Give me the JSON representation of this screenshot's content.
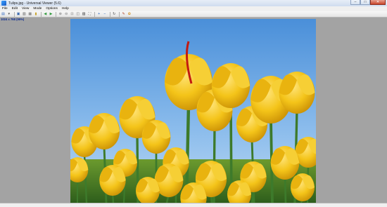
{
  "window": {
    "title": "Tulips.jpg - Universal Viewer (5.6)",
    "controls": [
      "–",
      "□",
      "✕"
    ]
  },
  "menu": {
    "items": [
      "File",
      "Edit",
      "View",
      "Mode",
      "Options",
      "Help"
    ]
  },
  "toolbar": {
    "buttons": [
      {
        "name": "open-icon",
        "glyph": "▤",
        "color": "#3a6fc4"
      },
      {
        "name": "dropdown-icon",
        "glyph": "▾",
        "color": "#444444"
      },
      {
        "name": "save-icon",
        "glyph": "▣",
        "color": "#2d5fa8"
      },
      {
        "name": "print-icon",
        "glyph": "▥",
        "color": "#555555"
      },
      {
        "name": "properties-icon",
        "glyph": "▦",
        "color": "#6a6a6a"
      },
      {
        "name": "delete-icon",
        "glyph": "▮",
        "color": "#c8a020"
      },
      {
        "name": "back-icon",
        "glyph": "◀",
        "color": "#2e9a3a"
      },
      {
        "name": "forward-icon",
        "glyph": "▶",
        "color": "#2e9a3a"
      },
      {
        "name": "zoom-in-icon",
        "glyph": "⊕",
        "color": "#777777"
      },
      {
        "name": "zoom-out-icon",
        "glyph": "⊖",
        "color": "#777777"
      },
      {
        "name": "zoom-fit-icon",
        "glyph": "⊡",
        "color": "#777777"
      },
      {
        "name": "actual-size-icon",
        "glyph": "◫",
        "color": "#777777"
      },
      {
        "name": "view-mode-icon",
        "glyph": "▨",
        "color": "#3a3a3a"
      },
      {
        "name": "fit-window-icon",
        "glyph": "⛶",
        "color": "#555555"
      },
      {
        "name": "add-icon",
        "glyph": "+",
        "color": "#1e5bb8"
      },
      {
        "name": "remove-icon",
        "glyph": "−",
        "color": "#1e5bb8"
      },
      {
        "name": "rotate-icon",
        "glyph": "↻",
        "color": "#444444"
      },
      {
        "name": "edit-icon",
        "glyph": "✎",
        "color": "#b04020"
      },
      {
        "name": "plugin-icon",
        "glyph": "✿",
        "color": "#d28a10"
      }
    ]
  },
  "info": {
    "dimensions": "1024 x 768 (95%)"
  },
  "image": {
    "file": "Tulips.jpg",
    "sky_color": "#5b9ce0",
    "petal_color": "#f2c21a",
    "stem_color": "#3d7a2b"
  }
}
